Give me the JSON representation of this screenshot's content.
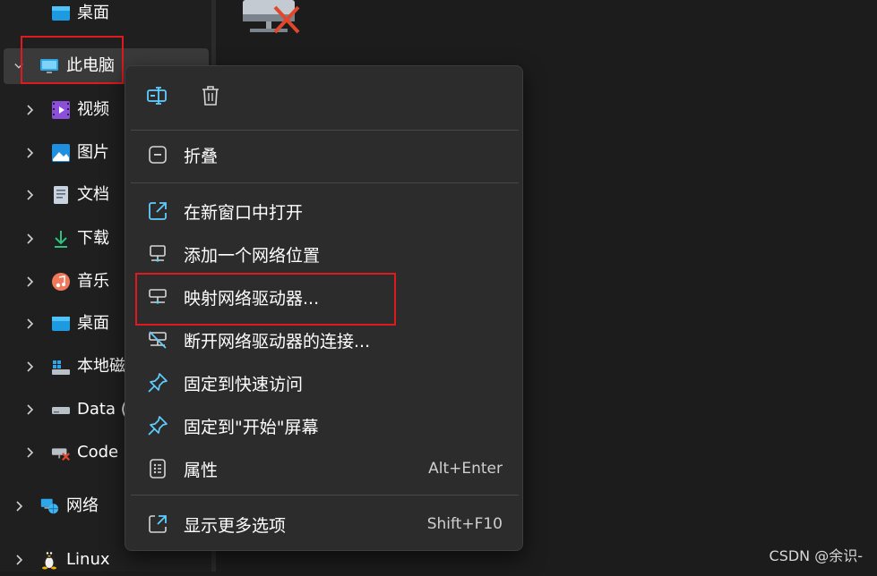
{
  "nav": {
    "items": [
      {
        "label": "桌面",
        "icon": "desktop-icon"
      },
      {
        "label": "此电脑",
        "icon": "monitor-icon"
      },
      {
        "label": "视频",
        "icon": "video-icon"
      },
      {
        "label": "图片",
        "icon": "pictures-icon"
      },
      {
        "label": "文档",
        "icon": "documents-icon"
      },
      {
        "label": "下载",
        "icon": "download-icon"
      },
      {
        "label": "音乐",
        "icon": "music-icon"
      },
      {
        "label": "桌面",
        "icon": "desktop-icon"
      },
      {
        "label": "本地磁",
        "icon": "local-disk-icon"
      },
      {
        "label": "Data (",
        "icon": "drive-icon"
      },
      {
        "label": "Code (",
        "icon": "network-drive-disconnected-icon"
      },
      {
        "label": "网络",
        "icon": "network-icon"
      },
      {
        "label": "Linux",
        "icon": "linux-penguin-icon"
      }
    ]
  },
  "context_menu": {
    "toolbar": [
      {
        "icon": "rename-icon"
      },
      {
        "icon": "delete-icon"
      }
    ],
    "collapse": {
      "label": "折叠",
      "icon": "collapse-icon"
    },
    "items": [
      {
        "label": "在新窗口中打开",
        "icon": "open-new-window-icon",
        "shortcut": ""
      },
      {
        "label": "添加一个网络位置",
        "icon": "add-network-location-icon",
        "shortcut": ""
      },
      {
        "label": "映射网络驱动器...",
        "icon": "map-network-drive-icon",
        "shortcut": ""
      },
      {
        "label": "断开网络驱动器的连接...",
        "icon": "disconnect-network-drive-icon",
        "shortcut": ""
      },
      {
        "label": "固定到快速访问",
        "icon": "pin-icon",
        "shortcut": ""
      },
      {
        "label": "固定到\"开始\"屏幕",
        "icon": "pin-icon",
        "shortcut": ""
      },
      {
        "label": "属性",
        "icon": "properties-icon",
        "shortcut": "Alt+Enter"
      }
    ],
    "more": {
      "label": "显示更多选项",
      "icon": "show-more-options-icon",
      "shortcut": "Shift+F10"
    }
  },
  "watermark": "CSDN @余识-",
  "colors": {
    "highlight_box": "#e0191f",
    "menu_bg": "#2c2c2c",
    "accent": "#60cdff"
  }
}
